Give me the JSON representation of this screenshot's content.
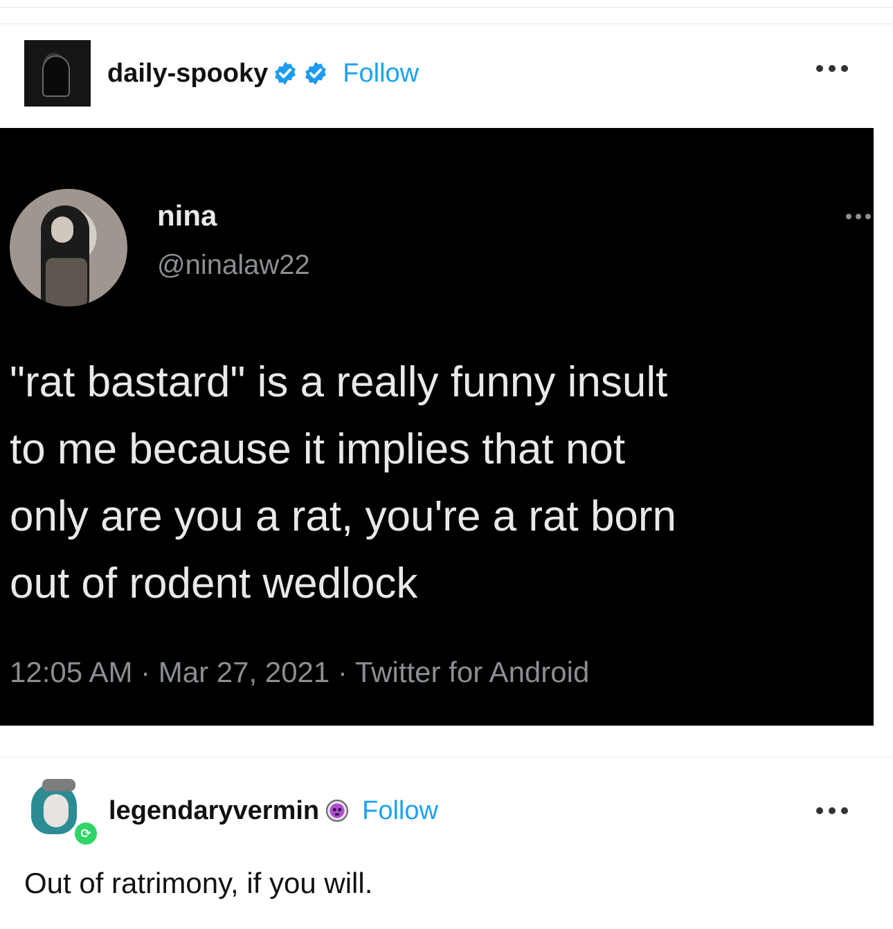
{
  "post": {
    "author": "daily-spooky",
    "follow_label": "Follow",
    "badges": [
      "verified-badge-icon",
      "verified-badge-icon"
    ],
    "menu_icon": "more-horizontal-icon"
  },
  "tweet": {
    "name": "nina",
    "handle": "@ninalaw22",
    "text": "\"rat bastard\" is a really funny insult\nto me because it implies that not\nonly are you a rat, you're a rat born\nout of rodent wedlock",
    "meta": "12:05 AM · Mar 27, 2021 · Twitter for Android",
    "menu_icon": "more-horizontal-icon"
  },
  "reblog": {
    "author": "legendaryvermin",
    "follow_label": "Follow",
    "badge_icon": "skull-badge-icon",
    "reblog_icon": "reblog-icon",
    "comment": "Out of ratrimony, if you will.",
    "menu_icon": "more-horizontal-icon"
  },
  "colors": {
    "follow": "#1da1f2",
    "verified": "#1d9bf0",
    "tweet_bg": "#000000",
    "tweet_text": "#e7e9ea",
    "tweet_muted": "#8b8f93",
    "reblog_green": "#2fd566"
  }
}
